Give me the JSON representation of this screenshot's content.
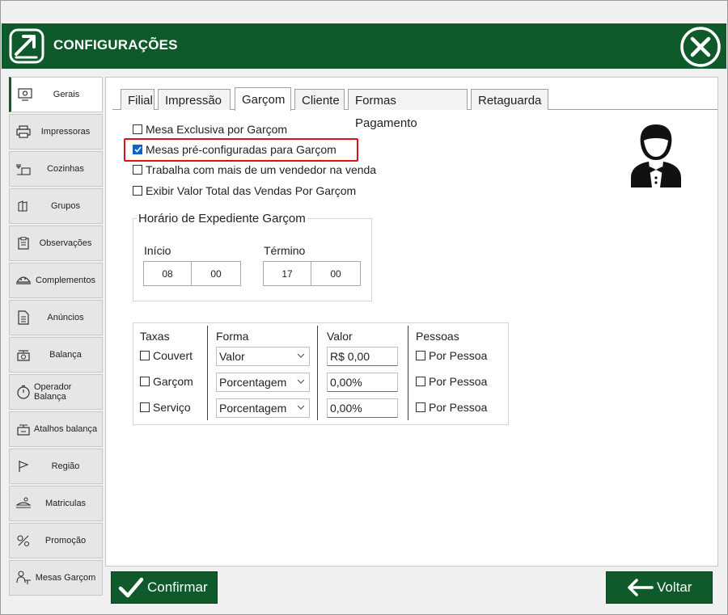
{
  "window": {
    "title": "CONFIGURAÇÕES"
  },
  "sidebar": {
    "items": [
      {
        "label": "Gerais",
        "icon": "gear-monitor-icon",
        "active": true
      },
      {
        "label": "Impressoras",
        "icon": "printer-icon"
      },
      {
        "label": "Cozinhas",
        "icon": "kitchen-icon"
      },
      {
        "label": "Grupos",
        "icon": "groups-icon"
      },
      {
        "label": "Observações",
        "icon": "clipboard-icon"
      },
      {
        "label": "Complementos",
        "icon": "dish-icon"
      },
      {
        "label": "Anúncios",
        "icon": "document-icon"
      },
      {
        "label": "Balança",
        "icon": "scale-icon"
      },
      {
        "label": "Operador  Balança",
        "icon": "timer-icon"
      },
      {
        "label": "Atalhos balança",
        "icon": "shortcut-scale-icon"
      },
      {
        "label": "Região",
        "icon": "flag-icon"
      },
      {
        "label": "Matriculas",
        "icon": "registration-icon"
      },
      {
        "label": "Promoção",
        "icon": "promotion-icon"
      },
      {
        "label": "Mesas Garçom",
        "icon": "waiter-table-icon"
      }
    ]
  },
  "tabs": [
    {
      "label": "Filial"
    },
    {
      "label": "Impressão"
    },
    {
      "label": "Garçom",
      "active": true
    },
    {
      "label": "Cliente"
    },
    {
      "label": "Formas Pagamento"
    },
    {
      "label": "Retaguarda"
    }
  ],
  "options": [
    {
      "label": "Mesa Exclusiva por Garçom",
      "checked": false
    },
    {
      "label": "Mesas pré-configuradas para Garçom",
      "checked": true
    },
    {
      "label": "Trabalha com mais de um vendedor na venda",
      "checked": false
    },
    {
      "label": "Exibir Valor Total das Vendas Por Garçom",
      "checked": false
    }
  ],
  "schedule": {
    "title": "Horário de Expediente Garçom",
    "start_label": "Início",
    "start_hour": "08",
    "start_minute": "00",
    "end_label": "Término",
    "end_hour": "17",
    "end_minute": "00"
  },
  "fees": {
    "headers": {
      "taxas": "Taxas",
      "forma": "Forma",
      "valor": "Valor",
      "pessoas": "Pessoas"
    },
    "rows": [
      {
        "name": "Couvert",
        "forma": "Valor",
        "valor": "R$ 0,00",
        "pessoa": "Por Pessoa"
      },
      {
        "name": "Garçom",
        "forma": "Porcentagem",
        "valor": "0,00%",
        "pessoa": "Por Pessoa"
      },
      {
        "name": "Serviço",
        "forma": "Porcentagem",
        "valor": "0,00%",
        "pessoa": "Por Pessoa"
      }
    ]
  },
  "buttons": {
    "confirm": "Confirmar",
    "back": "Voltar"
  },
  "colors": {
    "header": "#0f5a2a",
    "highlight": "#e01010",
    "check": "#0a64c8"
  }
}
